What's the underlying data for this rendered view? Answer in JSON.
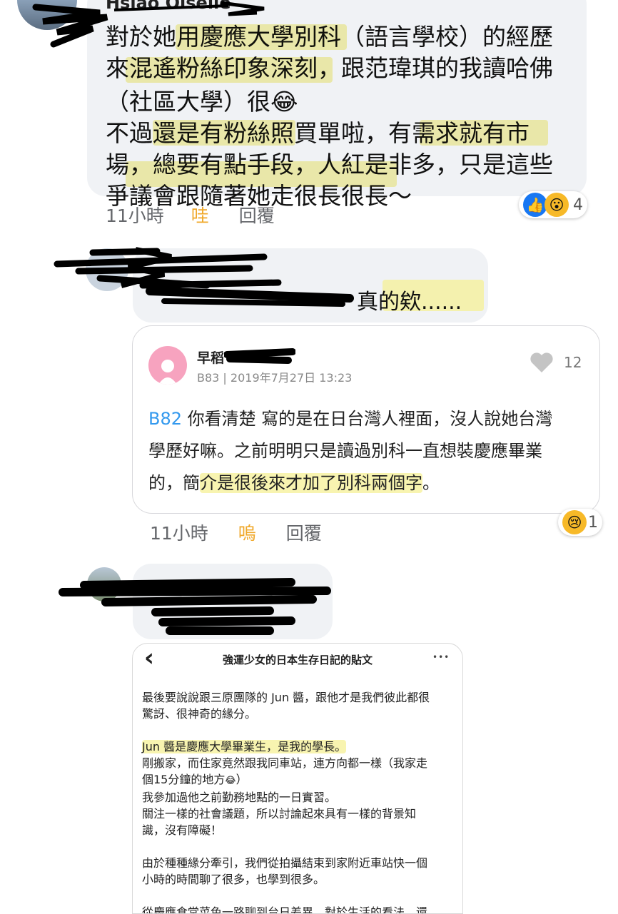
{
  "comment1": {
    "name_partial": "Hsiao Oiselle",
    "text_lines": [
      "對於她用慶應大學別科（語言學校）的經歷",
      "來混遙粉絲印象深刻，跟范瑋琪的我讀哈佛",
      "（社區大學）很",
      "不過還是有粉絲照買單啦，有需求就有市",
      "場，總要有點手段，人紅是非多，只是這些",
      "爭議會跟隨著她走很長很長～"
    ],
    "time": "11小時",
    "reaction_label": "哇",
    "reply_label": "回覆",
    "reaction_count": "4",
    "laugh_emoji": "😂"
  },
  "comment2": {
    "text": "真的欸......",
    "time": "11小時",
    "reaction_label": "嗚",
    "reply_label": "回覆",
    "reaction_count": "1",
    "quoted_post": {
      "author_prefix": "早稻",
      "meta": "B83 | 2019年7月27日 13:23",
      "likes": "12",
      "ref": "B82",
      "line1": "你看清楚 寫的是在日台灣人裡面，沒人說她台灣",
      "line2": "學歷好嘛。之前明明只是讀過別科一直想裝慶應畢業",
      "line3a": "的，簡",
      "line3b": "介是很後來才加了別科兩個字",
      "line3c": "。"
    }
  },
  "comment3": {
    "screenshot": {
      "title": "強運少女的日本生存日記的貼文",
      "back_icon": "‹",
      "more_icon": "•••",
      "p1_l1": "最後要說說跟三原團隊的 Jun 醬，跟他才是我們彼此都很",
      "p1_l2": "驚訝、很神奇的緣分。",
      "p2_l1": "Jun 醬是慶應大學畢業生，是我的學長。",
      "p2_l2a": "剛搬家，而住家竟然跟我同車站，",
      "p2_l2b": "連方向都一樣（我家走",
      "p2_l3": "個15分鐘的地方",
      "p2_l3_end": "）",
      "p2_l4": "我參加過他之前勤務地點的一日實習。",
      "p2_l5": "關注一樣的社會議題，所以討論起來具有一樣的背景知",
      "p2_l6": "識，沒有障礙！",
      "p3_l1": "由於種種緣分牽引，我們從拍攝結束到家附近車站快一個",
      "p3_l2": "小時的時間聊了很多，也學到很多。",
      "p4_l1": "從慶應食堂菜色一路聊到台日差異、對於生活的看法。還"
    }
  },
  "colors": {
    "bubble": "#f0f2f5",
    "highlight": "#f6f096",
    "reaction_orange": "#f0a82a",
    "link_blue": "#3399ee"
  }
}
